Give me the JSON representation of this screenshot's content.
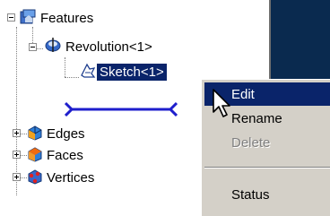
{
  "tree": {
    "nodes": [
      {
        "label": "Features",
        "icon": "features-icon"
      },
      {
        "label": "Revolution<1>",
        "icon": "revolution-icon"
      },
      {
        "label": "Sketch<1>",
        "icon": "sketch-icon",
        "selected": true
      },
      {
        "label": "Edges",
        "icon": "edges-icon"
      },
      {
        "label": "Faces",
        "icon": "faces-icon"
      },
      {
        "label": "Vertices",
        "icon": "vertices-icon"
      }
    ]
  },
  "context_menu": {
    "items": [
      {
        "label": "Edit",
        "state": "highlighted"
      },
      {
        "label": "Rename",
        "state": "enabled"
      },
      {
        "label": "Delete",
        "state": "disabled"
      },
      {
        "label": "Status",
        "state": "enabled"
      }
    ]
  },
  "colors": {
    "selection": "#0a246a",
    "menu_background": "#d4d0c8",
    "drag_marker": "#1e1ecc",
    "dark_panel": "#0a2a4f"
  }
}
